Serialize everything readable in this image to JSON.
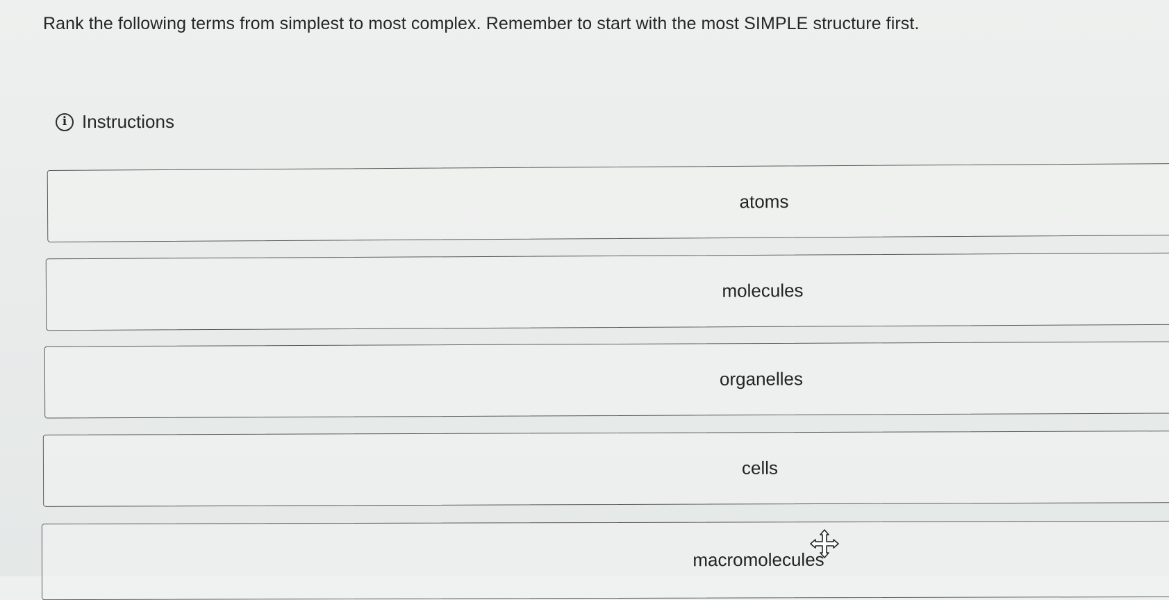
{
  "question": {
    "text": "Rank the following terms from simplest to most complex. Remember to start with the most SIMPLE structure first."
  },
  "instructions": {
    "icon": "info-icon",
    "label": "Instructions"
  },
  "ranking": {
    "items": [
      {
        "label": "atoms"
      },
      {
        "label": "molecules"
      },
      {
        "label": "organelles"
      },
      {
        "label": "cells"
      },
      {
        "label": "macromolecules"
      }
    ]
  },
  "cursor": {
    "icon": "move-cursor-icon"
  }
}
